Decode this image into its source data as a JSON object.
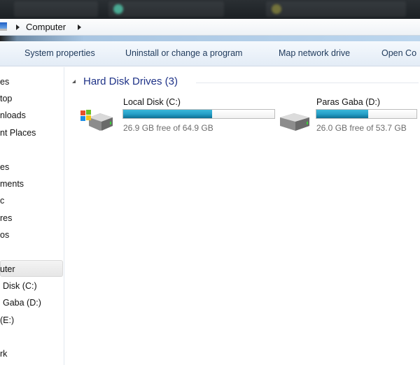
{
  "address_bar": {
    "crumb": "Computer"
  },
  "toolbar": {
    "items": [
      "System properties",
      "Uninstall or change a program",
      "Map network drive",
      "Open Co"
    ]
  },
  "sidebar": {
    "items": [
      "es",
      "top",
      "nloads",
      "nt Places",
      "es",
      "ments",
      "c",
      "res",
      "os",
      "uter",
      "Disk (C:)",
      "Gaba (D:)",
      "(E:)",
      "rk"
    ],
    "selected": "uter"
  },
  "group": {
    "title": "Hard Disk Drives (3)"
  },
  "drives": [
    {
      "name": "Local Disk (C:)",
      "free_text": "26.9 GB free of 64.9 GB",
      "used_percent": 58.6,
      "icon": "windows-hdd-icon"
    },
    {
      "name": "Paras Gaba (D:)",
      "free_text": "26.0 GB free of 53.7 GB",
      "used_percent": 51.6,
      "icon": "hdd-icon"
    }
  ],
  "colors": {
    "accent": "#1e3287",
    "bar_fill": "#26a0c8"
  }
}
